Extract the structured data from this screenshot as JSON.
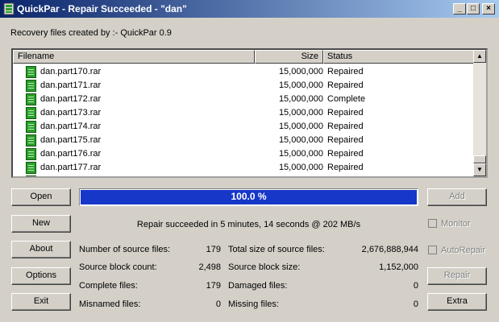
{
  "window": {
    "title": "QuickPar - Repair Succeeded - \"dan\"",
    "controls": {
      "minimize": "_",
      "maximize": "□",
      "close": "×"
    }
  },
  "recovery_info": "Recovery files created by :- QuickPar 0.9",
  "file_list": {
    "columns": {
      "filename": "Filename",
      "size": "Size",
      "status": "Status"
    },
    "rows": [
      {
        "name": "dan.part170.rar",
        "size": "15,000,000",
        "status": "Repaired"
      },
      {
        "name": "dan.part171.rar",
        "size": "15,000,000",
        "status": "Repaired"
      },
      {
        "name": "dan.part172.rar",
        "size": "15,000,000",
        "status": "Complete"
      },
      {
        "name": "dan.part173.rar",
        "size": "15,000,000",
        "status": "Repaired"
      },
      {
        "name": "dan.part174.rar",
        "size": "15,000,000",
        "status": "Repaired"
      },
      {
        "name": "dan.part175.rar",
        "size": "15,000,000",
        "status": "Repaired"
      },
      {
        "name": "dan.part176.rar",
        "size": "15,000,000",
        "status": "Repaired"
      },
      {
        "name": "dan.part177.rar",
        "size": "15,000,000",
        "status": "Repaired"
      }
    ]
  },
  "progress": {
    "value": 1.0,
    "label": "100.0 %",
    "color": "#1737c9"
  },
  "status_message": "Repair succeeded in 5 minutes, 14 seconds @ 202 MB/s",
  "buttons": {
    "open": "Open",
    "new": "New",
    "about": "About",
    "options": "Options",
    "exit": "Exit",
    "add": "Add",
    "repair": "Repair",
    "extra": "Extra"
  },
  "checkboxes": {
    "monitor": "Monitor",
    "autorepair": "AutoRepair"
  },
  "stats": {
    "source_files_label": "Number of source files:",
    "source_files": "179",
    "block_count_label": "Source block count:",
    "block_count": "2,498",
    "complete_label": "Complete files:",
    "complete": "179",
    "misnamed_label": "Misnamed files:",
    "misnamed": "0",
    "total_size_label": "Total size of source files:",
    "total_size": "2,676,888,944",
    "block_size_label": "Source block size:",
    "block_size": "1,152,000",
    "damaged_label": "Damaged files:",
    "damaged": "0",
    "missing_label": "Missing files:",
    "missing": "0"
  }
}
